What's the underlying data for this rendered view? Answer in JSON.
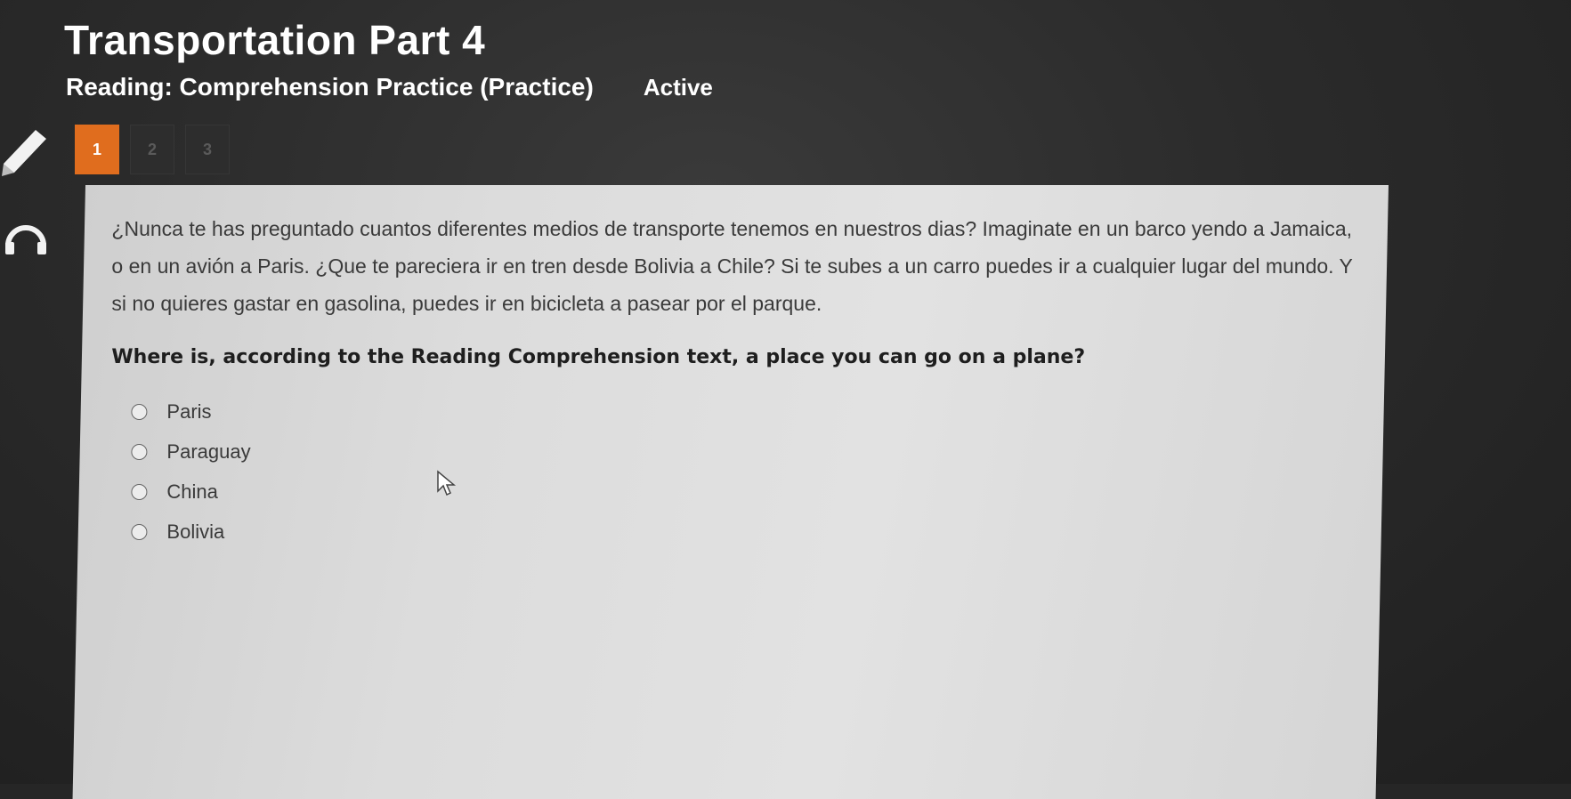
{
  "header": {
    "title": "Transportation Part 4",
    "subtitle": "Reading: Comprehension Practice (Practice)",
    "status": "Active"
  },
  "toolbar": {
    "tools": [
      "pencil-icon",
      "headphones-icon"
    ]
  },
  "pager": {
    "pages": [
      "1",
      "2",
      "3"
    ],
    "current": "1"
  },
  "passage": {
    "text": "¿Nunca te has preguntado cuantos diferentes medios de transporte tenemos en nuestros dias? Imaginate en un barco yendo a Jamaica, o en un avión a Paris. ¿Que te pareciera ir en tren desde Bolivia a Chile? Si te subes a un carro puedes ir a cualquier lugar del mundo. Y si no quieres gastar en gasolina, puedes ir en bicicleta a pasear por el parque."
  },
  "question": {
    "text": "Where is, according to the Reading Comprehension text, a place you can go on a plane?",
    "options": [
      {
        "label": "Paris"
      },
      {
        "label": "Paraguay"
      },
      {
        "label": "China"
      },
      {
        "label": "Bolivia"
      }
    ]
  },
  "colors": {
    "accent": "#e06d1e",
    "panel": "#dcdcdc",
    "background": "#262626"
  }
}
